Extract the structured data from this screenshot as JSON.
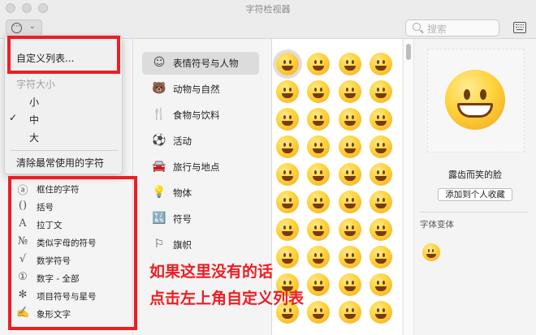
{
  "window": {
    "title": "字符检视器"
  },
  "toolbar": {
    "search_placeholder": "搜索"
  },
  "menu": {
    "customize_label": "自定义列表...",
    "size_header": "字符大小",
    "sizes": [
      "小",
      "中",
      "大"
    ],
    "selected_size": "中",
    "clear_recent_label": "清除最常使用的字符"
  },
  "left_list": [
    {
      "icon_glyph": "ⓐ",
      "icon": "circled-letter-icon",
      "label": "框住的字符"
    },
    {
      "icon_glyph": "()",
      "icon": "parentheses-icon",
      "label": "括号"
    },
    {
      "icon_glyph": "A",
      "icon": "latin-letter-icon",
      "label": "拉丁文"
    },
    {
      "icon_glyph": "№",
      "icon": "numero-sign-icon",
      "label": "类似字母的符号"
    },
    {
      "icon_glyph": "√",
      "icon": "square-root-icon",
      "label": "数学符号"
    },
    {
      "icon_glyph": "①",
      "icon": "circled-one-icon",
      "label": "数字 - 全部"
    },
    {
      "icon_glyph": "✻",
      "icon": "asterisk-icon",
      "label": "项目符号与星号"
    },
    {
      "icon_glyph": "✍",
      "icon": "writing-hand-icon",
      "label": "象形文字"
    }
  ],
  "categories": [
    {
      "icon_glyph": "☺",
      "icon": "smiley-icon",
      "label": "表情符号与人物",
      "selected": true
    },
    {
      "icon_glyph": "🐻",
      "icon": "bear-icon",
      "label": "动物与自然"
    },
    {
      "icon_glyph": "🍴",
      "icon": "food-icon",
      "label": "食物与饮料"
    },
    {
      "icon_glyph": "⚽",
      "icon": "ball-icon",
      "label": "活动"
    },
    {
      "icon_glyph": "🚘",
      "icon": "car-icon",
      "label": "旅行与地点"
    },
    {
      "icon_glyph": "💡",
      "icon": "lightbulb-icon",
      "label": "物体"
    },
    {
      "icon_glyph": "🔣",
      "icon": "symbols-icon",
      "label": "符号"
    },
    {
      "icon_glyph": "⚐",
      "icon": "flag-icon",
      "label": "旗帜"
    }
  ],
  "detail": {
    "emoji_name": "露齿而笑的脸",
    "add_favorite_label": "添加到个人收藏",
    "variants_title": "字体变体"
  },
  "annotation": {
    "line1": "如果这里没有的话",
    "line2": "点击左上角自定义列表"
  }
}
